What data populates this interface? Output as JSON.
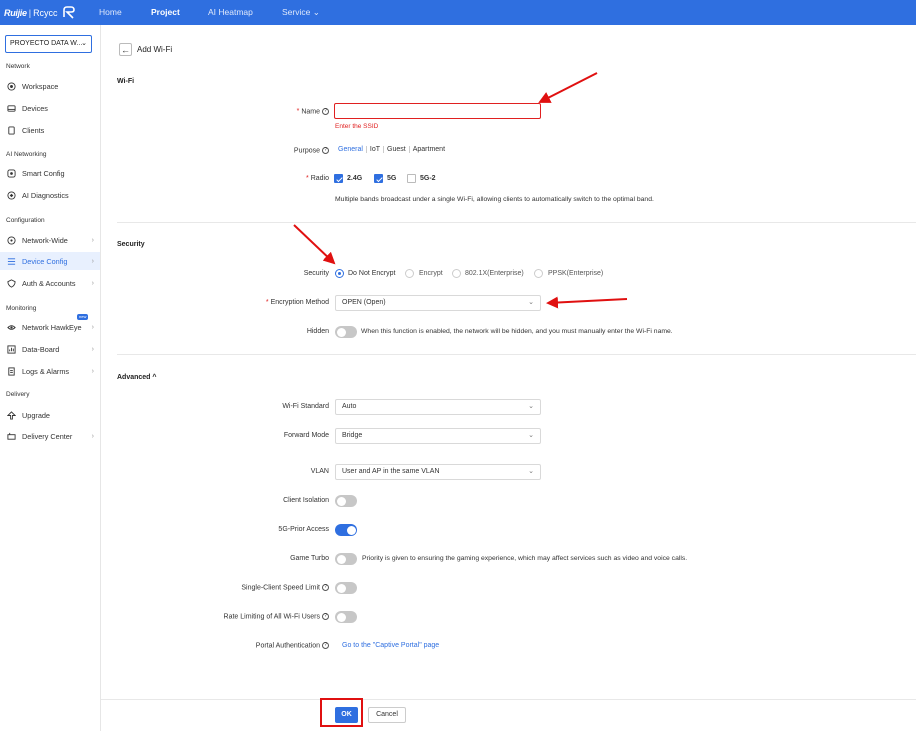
{
  "topbar": {
    "brand": "Ruijie",
    "brand_sub": "Rcycc",
    "nav": [
      "Home",
      "Project",
      "AI Heatmap",
      "Service"
    ],
    "active": "Project"
  },
  "sidebar": {
    "project_select": "PROYECTO DATA W...",
    "sections": {
      "network": "Network",
      "ai": "AI Networking",
      "config": "Configuration",
      "monitoring": "Monitoring",
      "delivery": "Delivery"
    },
    "items": [
      {
        "label": "Workspace",
        "icon": "target-icon"
      },
      {
        "label": "Devices",
        "icon": "device-icon"
      },
      {
        "label": "Clients",
        "icon": "clients-icon"
      },
      {
        "label": "Smart Config",
        "icon": "smart-config-icon"
      },
      {
        "label": "AI Diagnostics",
        "icon": "diagnostics-icon"
      },
      {
        "label": "Network-Wide",
        "icon": "globe-icon"
      },
      {
        "label": "Device Config",
        "icon": "list-icon"
      },
      {
        "label": "Auth & Accounts",
        "icon": "shield-icon"
      },
      {
        "label": "Network HawkEye",
        "icon": "eye-icon",
        "badge": "new"
      },
      {
        "label": "Data-Board",
        "icon": "board-icon"
      },
      {
        "label": "Logs & Alarms",
        "icon": "logs-icon"
      },
      {
        "label": "Upgrade",
        "icon": "upgrade-icon"
      },
      {
        "label": "Delivery Center",
        "icon": "delivery-icon"
      }
    ],
    "active": "Device Config"
  },
  "page": {
    "title": "Add Wi-Fi",
    "wifi_section": "Wi-Fi",
    "name_label": "Name",
    "name_value": "",
    "name_error": "Enter the SSID",
    "purpose_label": "Purpose",
    "purpose_options": [
      "General",
      "IoT",
      "Guest",
      "Apartment"
    ],
    "purpose_selected": "General",
    "radio_label": "Radio",
    "radio_options": [
      {
        "label": "2.4G",
        "checked": true
      },
      {
        "label": "5G",
        "checked": true
      },
      {
        "label": "5G-2",
        "checked": false
      }
    ],
    "radio_note": "Multiple bands broadcast under a single Wi-Fi, allowing clients to automatically switch to the optimal band.",
    "security_section": "Security",
    "security_label": "Security",
    "security_options": [
      "Do Not Encrypt",
      "Encrypt",
      "802.1X(Enterprise)",
      "PPSK(Enterprise)"
    ],
    "security_selected": "Do Not Encrypt",
    "encryption_label": "Encryption Method",
    "encryption_value": "OPEN (Open)",
    "hidden_label": "Hidden",
    "hidden_on": false,
    "hidden_note": "When this function is enabled, the network will be hidden, and you must manually enter the Wi-Fi name.",
    "advanced_section": "Advanced",
    "wifi_standard_label": "Wi-Fi Standard",
    "wifi_standard_value": "Auto",
    "forward_mode_label": "Forward Mode",
    "forward_mode_value": "Bridge",
    "vlan_label": "VLAN",
    "vlan_value": "User and AP in the same VLAN",
    "client_isolation_label": "Client Isolation",
    "client_isolation_on": false,
    "prior_access_label": "5G-Prior Access",
    "prior_access_on": true,
    "game_turbo_label": "Game Turbo",
    "game_turbo_on": false,
    "game_turbo_note": "Priority is given to ensuring the gaming experience, which may affect services such as video and voice calls.",
    "speed_limit_label": "Single-Client Speed Limit",
    "speed_limit_on": false,
    "rate_limit_label": "Rate Limiting of All Wi-Fi Users",
    "rate_limit_on": false,
    "portal_label": "Portal Authentication",
    "portal_link": "Go to the \"Captive Portal\" page",
    "ok": "OK",
    "cancel": "Cancel"
  },
  "colors": {
    "accent": "#2f6fe0",
    "error": "#e02020",
    "annotation": "#e01010"
  }
}
